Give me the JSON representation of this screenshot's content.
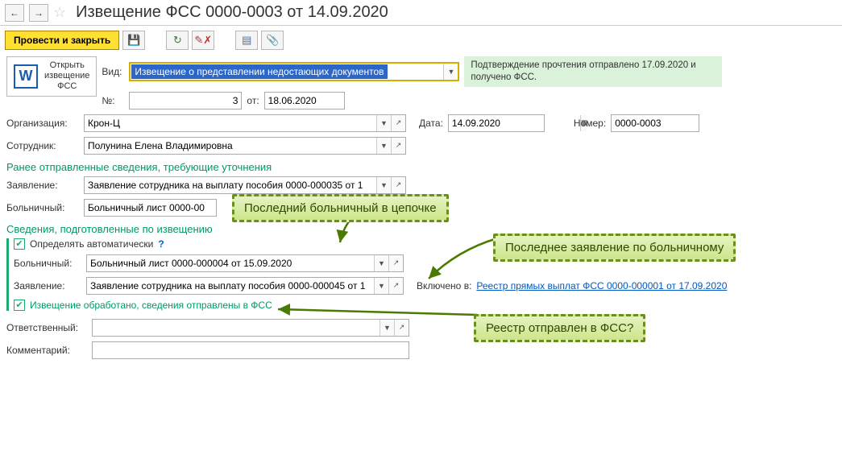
{
  "nav": {
    "back": "←",
    "fwd": "→"
  },
  "title": "Извещение ФСС 0000-0003 от 14.09.2020",
  "toolbar": {
    "post_close": "Провести и закрыть"
  },
  "open_fss": {
    "line1": "Открыть",
    "line2": "извещение",
    "line3": "ФСС"
  },
  "vid": {
    "label": "Вид:",
    "value": "Извещение о представлении недостающих документов"
  },
  "confirm_note": "Подтверждение прочтения отправлено 17.09.2020 и получено ФСС.",
  "num": {
    "label": "№:",
    "value": "3"
  },
  "ot": {
    "label": "от:",
    "value": "18.06.2020"
  },
  "org": {
    "label": "Организация:",
    "value": "Крон-Ц"
  },
  "date": {
    "label": "Дата:",
    "value": "14.09.2020"
  },
  "nomer": {
    "label": "Номер:",
    "value": "0000-0003"
  },
  "emp": {
    "label": "Сотрудник:",
    "value": "Полунина Елена Владимировна"
  },
  "section1": "Ранее отправленные сведения, требующие уточнения",
  "zayav1": {
    "label": "Заявление:",
    "value": "Заявление сотрудника на выплату пособия 0000-000035 от 1"
  },
  "boln1": {
    "label": "Больничный:",
    "value": "Больничный лист 0000-00"
  },
  "section2": "Сведения, подготовленные по извещению",
  "auto": {
    "label": "Определять автоматически",
    "checked": true
  },
  "boln2": {
    "label": "Больничный:",
    "value": "Больничный лист 0000-000004 от 15.09.2020"
  },
  "zayav2": {
    "label": "Заявление:",
    "value": "Заявление сотрудника на выплату пособия 0000-000045 от 1"
  },
  "incl": {
    "label": "Включено в:",
    "link": "Реестр прямых выплат ФСС 0000-000001 от 17.09.2020"
  },
  "processed": {
    "label": "Извещение обработано, сведения отправлены в ФСС",
    "checked": true
  },
  "resp": {
    "label": "Ответственный:"
  },
  "comment": {
    "label": "Комментарий:"
  },
  "callouts": {
    "c1": "Последний больничный в цепочке",
    "c2": "Последнее заявление по больничному",
    "c3": "Реестр отправлен в ФСС?"
  }
}
